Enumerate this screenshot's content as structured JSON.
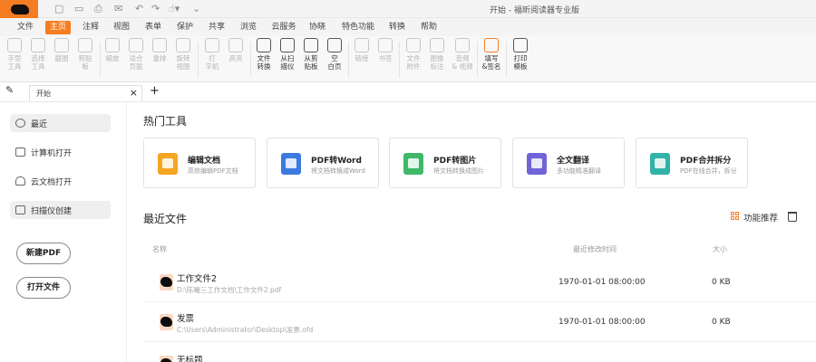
{
  "window": {
    "title": "开始 - 福昕阅读器专业版"
  },
  "menu_tabs": [
    "文件",
    "主页",
    "注释",
    "视图",
    "表单",
    "保护",
    "共享",
    "浏览",
    "云服务",
    "协晓",
    "特色功能",
    "转换",
    "帮助"
  ],
  "active_tab": "主页",
  "ribbon": [
    {
      "label": "手型\n工具",
      "icon": "hand-icon",
      "enabled": false
    },
    {
      "label": "选择\n工具",
      "icon": "select-icon",
      "enabled": false
    },
    {
      "label": "截图",
      "icon": "screenshot-icon",
      "enabled": false
    },
    {
      "label": "剪贴\n板",
      "icon": "clipboard-icon",
      "enabled": false
    },
    {
      "label": "缩放",
      "icon": "zoom-icon",
      "enabled": false
    },
    {
      "label": "适合\n页面",
      "icon": "fit-page-icon",
      "enabled": false
    },
    {
      "label": "重排",
      "icon": "reflow-icon",
      "enabled": false
    },
    {
      "label": "旋转\n视图",
      "icon": "rotate-icon",
      "enabled": false
    },
    {
      "label": "打\n字机",
      "icon": "typewriter-icon",
      "enabled": false
    },
    {
      "label": "高亮",
      "icon": "highlight-icon",
      "enabled": false
    },
    {
      "label": "文件\n转换",
      "icon": "file-convert-icon",
      "enabled": true
    },
    {
      "label": "从扫\n描仪",
      "icon": "scanner-icon",
      "enabled": true
    },
    {
      "label": "从剪\n贴板",
      "icon": "from-clipboard-icon",
      "enabled": true
    },
    {
      "label": "空\n白页",
      "icon": "blank-page-icon",
      "enabled": true
    },
    {
      "label": "链接",
      "icon": "link-icon",
      "enabled": false
    },
    {
      "label": "书签",
      "icon": "bookmark-icon",
      "enabled": false
    },
    {
      "label": "文件\n附件",
      "icon": "attachment-icon",
      "enabled": false
    },
    {
      "label": "图像\n标注",
      "icon": "image-annot-icon",
      "enabled": false
    },
    {
      "label": "音频\n& 视频",
      "icon": "audio-video-icon",
      "enabled": false
    },
    {
      "label": "填写\n&签名",
      "icon": "fill-sign-icon",
      "enabled": true
    },
    {
      "label": "打印\n模板",
      "icon": "print-icon",
      "enabled": true
    }
  ],
  "doc_tab": {
    "title": "开始",
    "close": "×",
    "add": "+"
  },
  "sidebar": {
    "items": [
      {
        "label": "最近",
        "icon": "clock-icon"
      },
      {
        "label": "计算机打开",
        "icon": "monitor-icon"
      },
      {
        "label": "云文档打开",
        "icon": "cloud-icon"
      },
      {
        "label": "扫描仪创建",
        "icon": "scanner-icon"
      }
    ],
    "new_pdf": "新建PDF",
    "open_file": "打开文件"
  },
  "hot_tools": {
    "title": "热门工具",
    "cards": [
      {
        "title": "编辑文档",
        "subtitle": "高效编辑PDF文档",
        "color": "#f5a623"
      },
      {
        "title": "PDF转Word",
        "subtitle": "将文档转换成Word",
        "color": "#3b7be0"
      },
      {
        "title": "PDF转图片",
        "subtitle": "将文档转换成图片",
        "color": "#3fb86a"
      },
      {
        "title": "全文翻译",
        "subtitle": "多功能精准翻译",
        "color": "#6f64d8"
      },
      {
        "title": "PDF合并拆分",
        "subtitle": "PDF在线合并，拆分",
        "color": "#32b3a8"
      }
    ]
  },
  "recent": {
    "title": "最近文件",
    "feature_recommend": "功能推荐",
    "columns": {
      "name": "名称",
      "modified": "最近修改时间",
      "size": "大小"
    },
    "files": [
      {
        "name": "工作文件2",
        "path": "D:\\陈曦三工作文档\\工作文件2.pdf",
        "modified": "1970-01-01 08:00:00",
        "size": "0 KB"
      },
      {
        "name": "发票",
        "path": "C:\\Users\\Administrator\\Desktop\\发票.ofd",
        "modified": "1970-01-01 08:00:00",
        "size": "0 KB"
      },
      {
        "name": "无标题",
        "path": "",
        "modified": "",
        "size": ""
      }
    ]
  },
  "colors": {
    "accent": "#f57d21"
  }
}
